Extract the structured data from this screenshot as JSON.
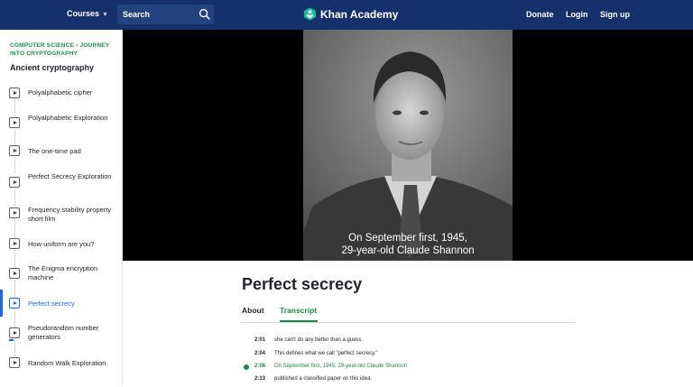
{
  "header": {
    "courses_label": "Courses",
    "search_placeholder": "Search",
    "logo_text": "Khan Academy",
    "nav": [
      "Donate",
      "Login",
      "Sign up"
    ]
  },
  "sidebar": {
    "breadcrumb": "COMPUTER SCIENCE › JOURNEY INTO CRYPTOGRAPHY",
    "topic": "Ancient cryptography",
    "lessons": [
      {
        "label": "Polyalphabetic cipher"
      },
      {
        "label": "Polyalphabetic Exploration"
      },
      {
        "label": "The one-time pad"
      },
      {
        "label": "Perfect Secrecy Exploration"
      },
      {
        "label": "Frequency stability property short film"
      },
      {
        "label": "How uniform are you?"
      },
      {
        "label": "The Enigma encryption machine"
      },
      {
        "label": "Perfect secrecy",
        "active": true
      },
      {
        "label": "Pseudorandom number generators",
        "progress": 0.4
      },
      {
        "label": "Random Walk Exploration"
      }
    ]
  },
  "video": {
    "caption_line1": "On September first, 1945,",
    "caption_line2": "29-year-old Claude Shannon"
  },
  "content": {
    "title": "Perfect secrecy",
    "tabs": [
      "About",
      "Transcript"
    ],
    "selected_tab": "Transcript",
    "transcript": [
      {
        "time": "2:01",
        "text": "she can't do any better than a guess."
      },
      {
        "time": "2:04",
        "text": "This defines what we call \"perfect secrecy.\""
      },
      {
        "time": "2:08",
        "text": "On September first, 1945, 29-year-old Claude Shannon",
        "current": true
      },
      {
        "time": "2:13",
        "text": "published a classified paper on this idea."
      }
    ]
  },
  "colors": {
    "header_bg": "#14316b",
    "accent_green": "#1b8a4a",
    "accent_blue": "#1865f2"
  }
}
